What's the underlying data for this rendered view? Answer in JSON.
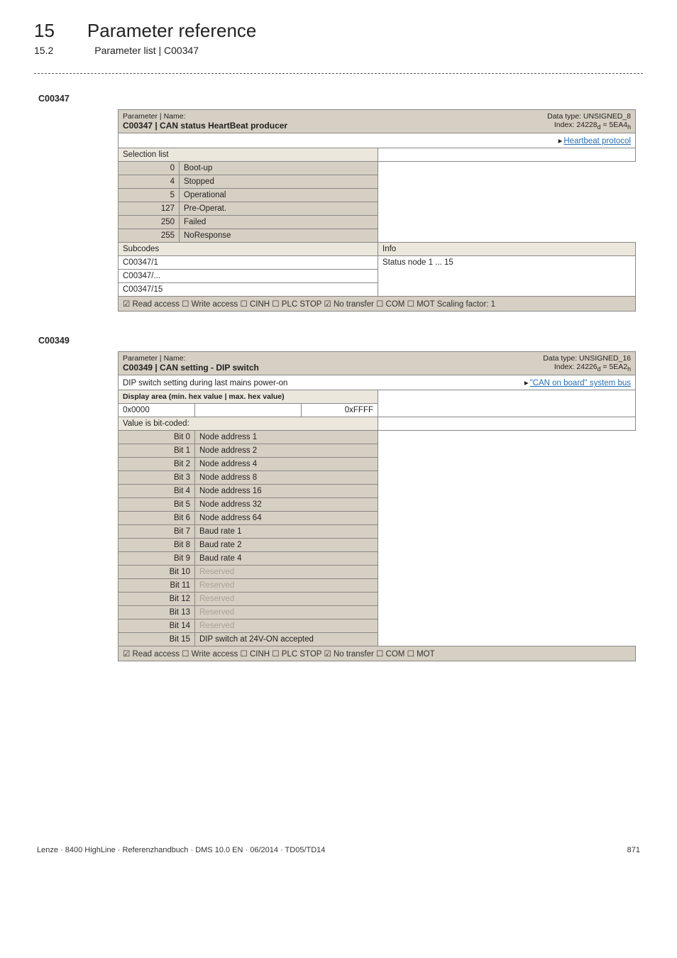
{
  "chapter": {
    "num": "15",
    "title": "Parameter reference"
  },
  "section": {
    "num": "15.2",
    "title": "Parameter list | C00347"
  },
  "c347": {
    "label": "C00347",
    "name_prefix": "Parameter | Name:",
    "name_bold": "C00347 | CAN status HeartBeat producer",
    "dtype": "Data type: UNSIGNED_8",
    "index": "Index: 24228",
    "index_sub": "d",
    "index_eq": " = 5EA4",
    "index_hsub": "h",
    "link": "Heartbeat protocol",
    "sel_header": "Selection list",
    "rows": [
      {
        "n": "0",
        "v": "Boot-up"
      },
      {
        "n": "4",
        "v": "Stopped"
      },
      {
        "n": "5",
        "v": "Operational"
      },
      {
        "n": "127",
        "v": "Pre-Operat."
      },
      {
        "n": "250",
        "v": "Failed"
      },
      {
        "n": "255",
        "v": "NoResponse"
      }
    ],
    "subcodes_header": "Subcodes",
    "info_header": "Info",
    "subs": [
      {
        "k": "C00347/1",
        "v": "Status node 1 ... 15"
      },
      {
        "k": "C00347/..."
      },
      {
        "k": "C00347/15"
      }
    ],
    "footer": "☑ Read access   ☐ Write access   ☐ CINH   ☐ PLC STOP   ☑ No transfer   ☐ COM   ☐ MOT    Scaling factor: 1"
  },
  "c349": {
    "label": "C00349",
    "name_prefix": "Parameter | Name:",
    "name_bold": "C00349 | CAN setting - DIP switch",
    "dtype": "Data type: UNSIGNED_16",
    "index": "Index: 24226",
    "index_sub": "d",
    "index_eq": " = 5EA2",
    "index_hsub": "h",
    "desc": "DIP switch setting during last mains power-on",
    "link": "\"CAN on board\" system bus",
    "disp_header": "Display area (min. hex value | max. hex value)",
    "min": "0x0000",
    "max": "0xFFFF",
    "bitcoded": "Value is bit-coded:",
    "bits": [
      {
        "k": "Bit 0",
        "v": "Node address 1"
      },
      {
        "k": "Bit 1",
        "v": "Node address 2"
      },
      {
        "k": "Bit 2",
        "v": "Node address 4"
      },
      {
        "k": "Bit 3",
        "v": "Node address 8"
      },
      {
        "k": "Bit 4",
        "v": "Node address 16"
      },
      {
        "k": "Bit 5",
        "v": "Node address 32"
      },
      {
        "k": "Bit 6",
        "v": "Node address 64"
      },
      {
        "k": "Bit 7",
        "v": "Baud rate 1"
      },
      {
        "k": "Bit 8",
        "v": "Baud rate 2"
      },
      {
        "k": "Bit 9",
        "v": "Baud rate 4"
      },
      {
        "k": "Bit 10",
        "v": "Reserved",
        "res": true
      },
      {
        "k": "Bit 11",
        "v": "Reserved",
        "res": true
      },
      {
        "k": "Bit 12",
        "v": "Reserved",
        "res": true
      },
      {
        "k": "Bit 13",
        "v": "Reserved",
        "res": true
      },
      {
        "k": "Bit 14",
        "v": "Reserved",
        "res": true
      },
      {
        "k": "Bit 15",
        "v": "DIP switch at 24V-ON accepted"
      }
    ],
    "footer": "☑ Read access   ☐ Write access   ☐ CINH   ☐ PLC STOP   ☑ No transfer   ☐ COM   ☐ MOT"
  },
  "footer": {
    "left": "Lenze · 8400 HighLine · Referenzhandbuch · DMS 10.0 EN · 06/2014 · TD05/TD14",
    "page": "871"
  }
}
